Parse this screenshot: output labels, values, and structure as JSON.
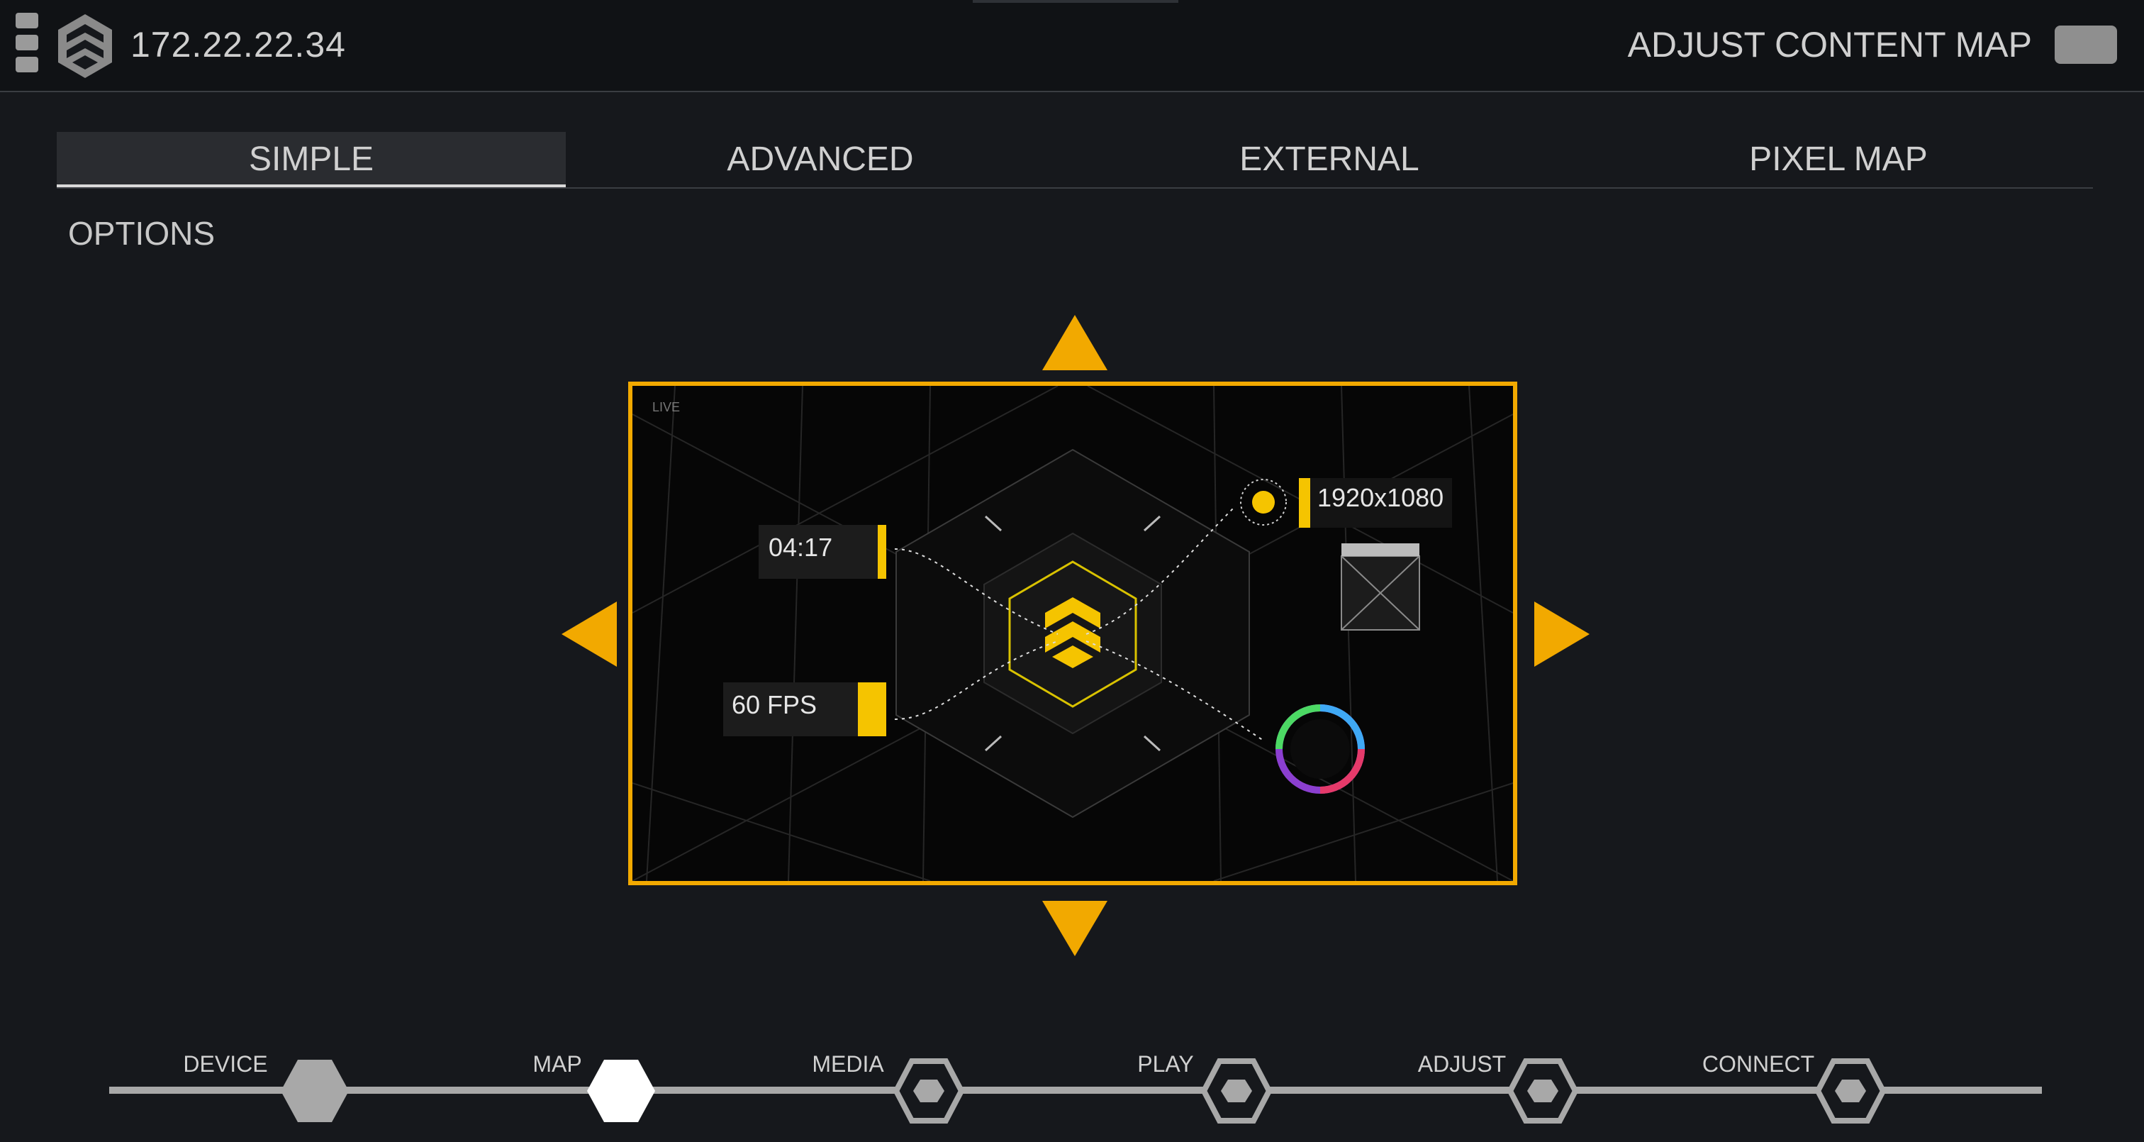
{
  "header": {
    "ip": "172.22.22.34",
    "adjust_label": "ADJUST CONTENT MAP",
    "adjust_toggle_on": false
  },
  "tabs": [
    {
      "label": "SIMPLE",
      "active": true
    },
    {
      "label": "ADVANCED",
      "active": false
    },
    {
      "label": "EXTERNAL",
      "active": false
    },
    {
      "label": "PIXEL MAP",
      "active": false
    }
  ],
  "section": {
    "title": "OPTIONS"
  },
  "preview": {
    "corner_label": "LIVE",
    "resolution": "1920x1080",
    "time": "04:17",
    "fps": "60 FPS"
  },
  "steps": [
    {
      "label": "DEVICE",
      "state": "done"
    },
    {
      "label": "MAP",
      "state": "current"
    },
    {
      "label": "MEDIA",
      "state": "pending"
    },
    {
      "label": "PLAY",
      "state": "pending"
    },
    {
      "label": "ADJUST",
      "state": "pending"
    },
    {
      "label": "CONNECT",
      "state": "pending"
    }
  ],
  "colors": {
    "accent": "#f2a900",
    "background": "#16181c",
    "topbar": "#101215",
    "step_done": "#a8a8a8",
    "step_current": "#ffffff"
  },
  "icons": {
    "menu": "menu-icon",
    "logo": "brand-shield-logo",
    "arrows": "triangle-arrow-icon"
  }
}
